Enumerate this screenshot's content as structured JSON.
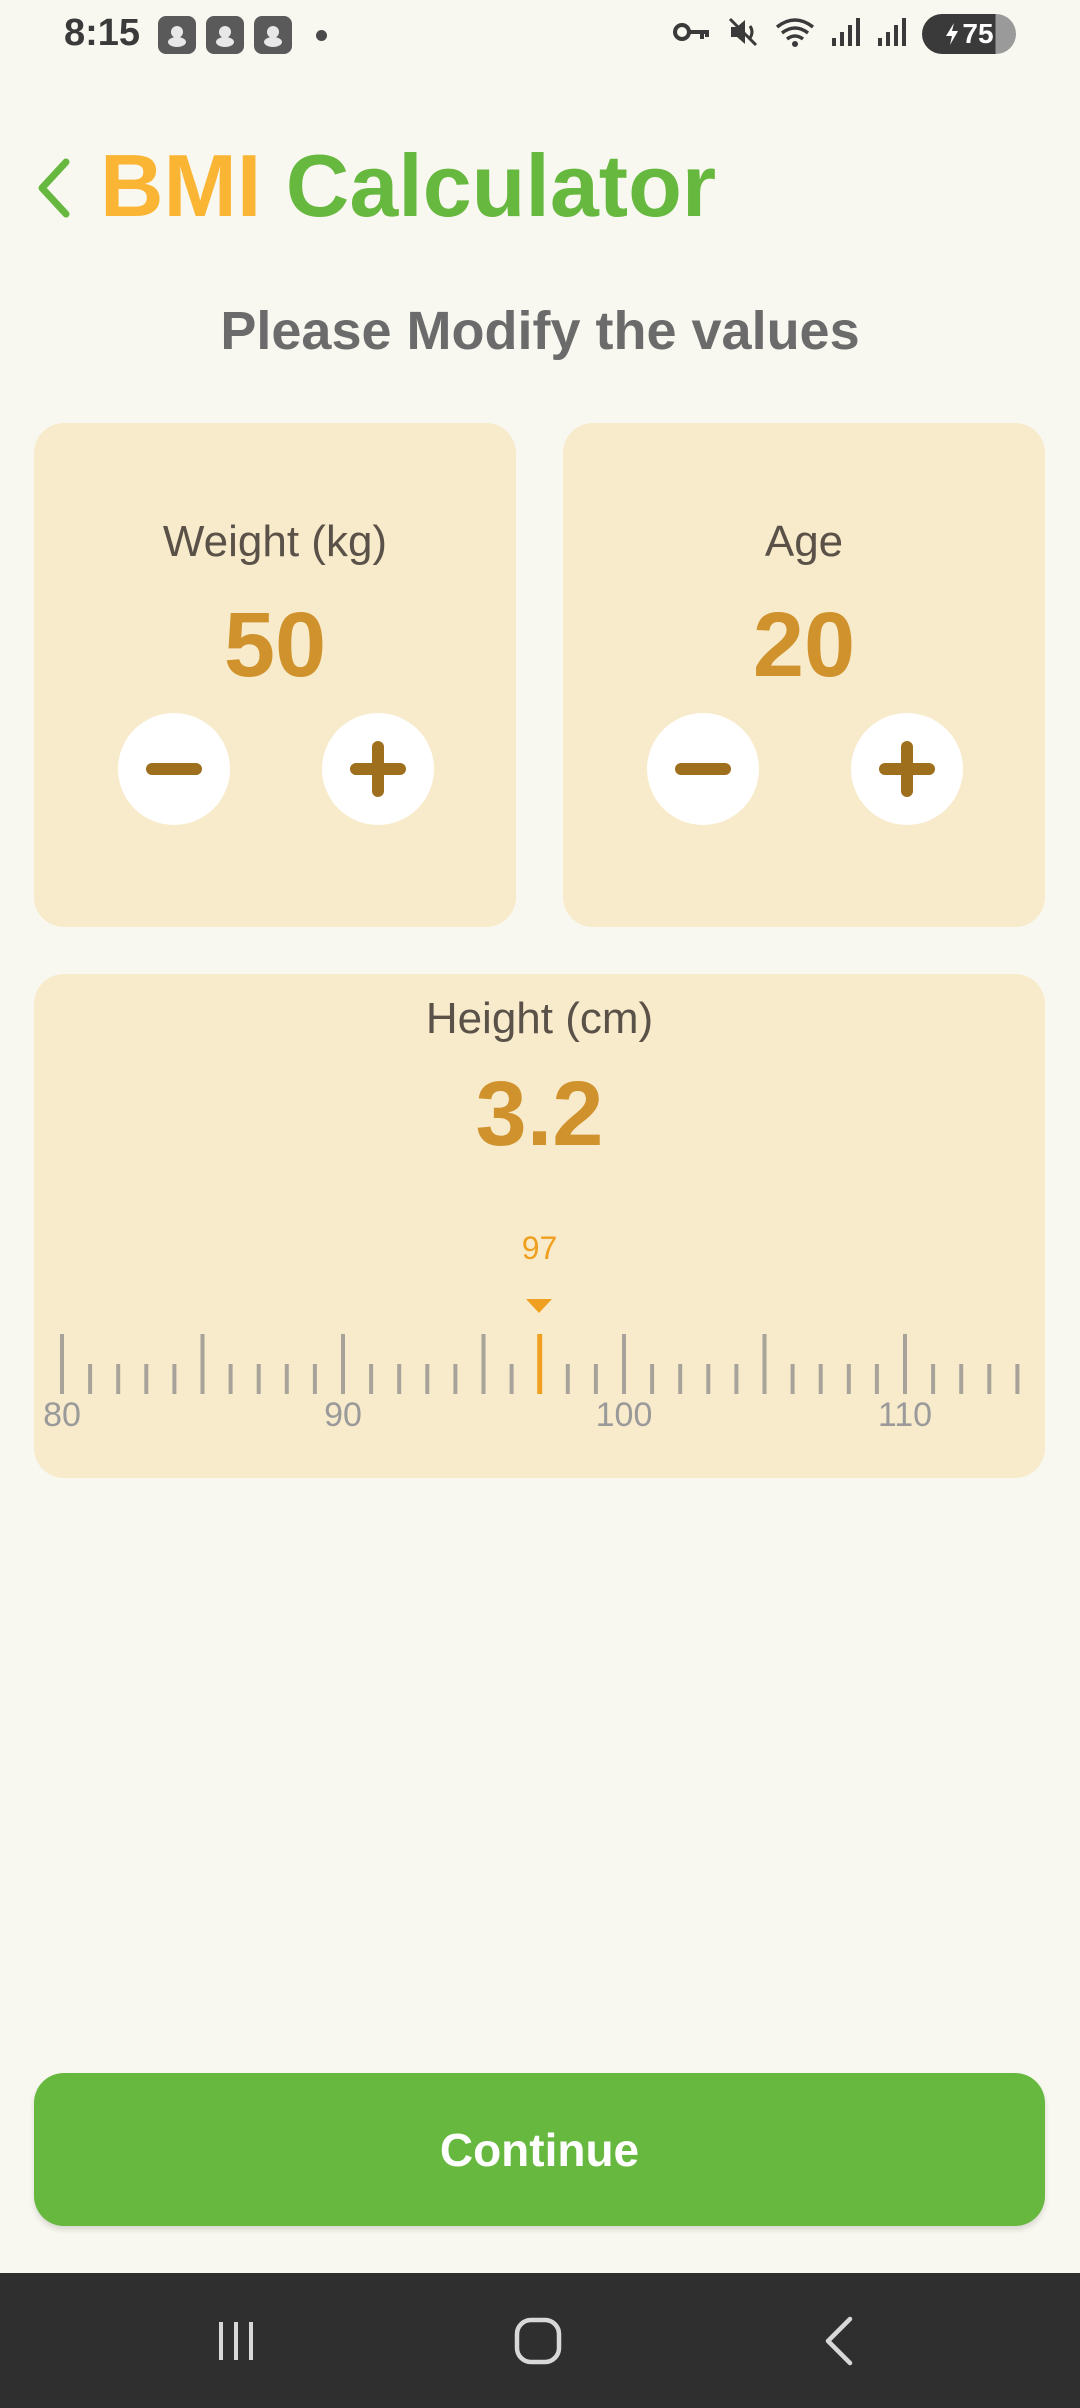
{
  "status_bar": {
    "time": "8:15",
    "battery_level": "75",
    "icons": [
      "app-notification-icon",
      "app-notification-icon",
      "app-notification-icon",
      "notification-dot",
      "vpn-key-icon",
      "mute-icon",
      "wifi-icon",
      "signal-icon",
      "signal-icon",
      "battery-charging-icon"
    ]
  },
  "header": {
    "title_part1": "BMI",
    "title_part2": "Calculator",
    "back_icon": "chevron-left-icon"
  },
  "subtitle": "Please Modify the values",
  "weight_card": {
    "label": "Weight (kg)",
    "value": "50"
  },
  "age_card": {
    "label": "Age",
    "value": "20"
  },
  "height_card": {
    "label": "Height (cm)",
    "value": "3.2",
    "ruler": {
      "selected": "97",
      "labels": [
        "80",
        "90",
        "100",
        "110"
      ]
    }
  },
  "continue_label": "Continue",
  "colors": {
    "background": "#F8F8F0",
    "card": "#F8EBCB",
    "accent_orange": "#FBB534",
    "accent_green": "#67B83F",
    "value_color": "#D0922C",
    "pointer_color": "#F0A020",
    "icon_brown": "#9E6F1C"
  }
}
